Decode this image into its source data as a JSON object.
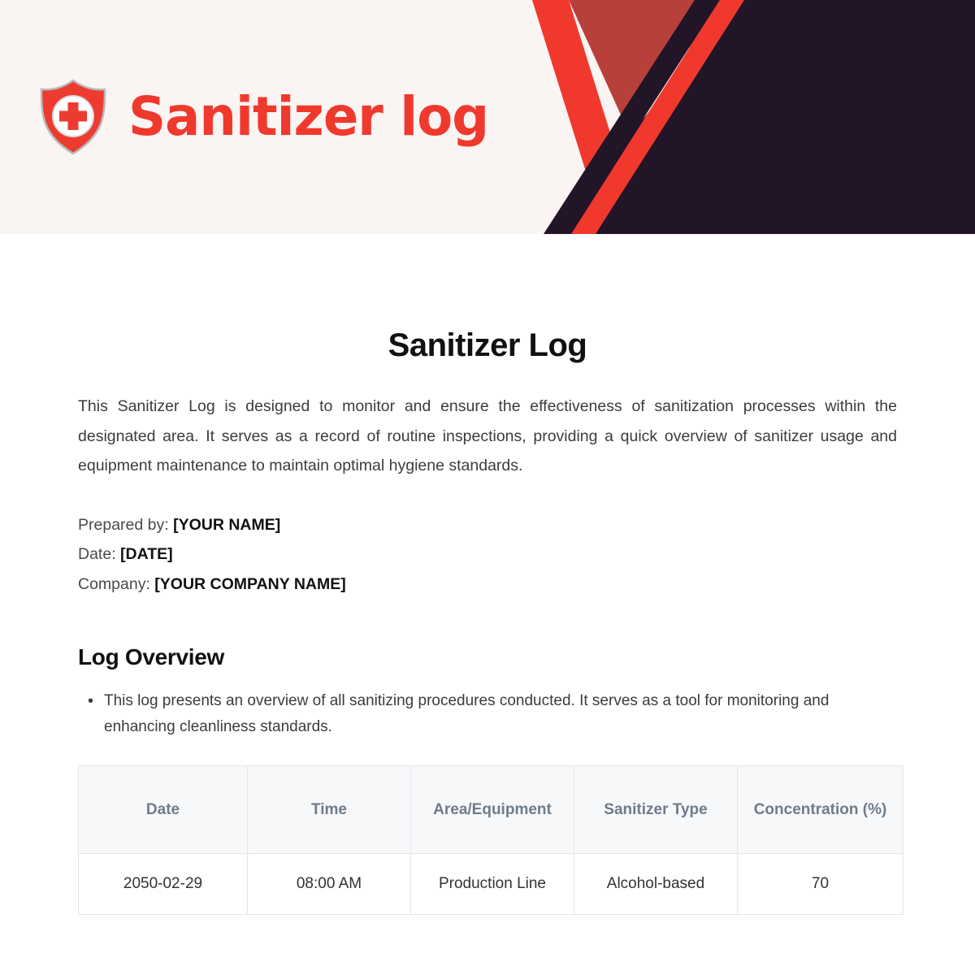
{
  "banner": {
    "title": "Sanitizer log",
    "logo_icon": "shield-medical-cross-icon",
    "colors": {
      "background": "#faf4f3",
      "title_red": "#f0392d",
      "bright_red": "#f1382c",
      "muted_red": "#b8403a",
      "dark": "#211527"
    }
  },
  "document": {
    "title": "Sanitizer Log",
    "intro": "This Sanitizer Log is designed to monitor and ensure the effectiveness of sanitization processes within the designated area. It serves as a record of routine inspections, providing a quick overview of sanitizer usage and equipment maintenance to maintain optimal hygiene standards.",
    "meta": [
      {
        "label": "Prepared by:",
        "value": "[YOUR NAME]"
      },
      {
        "label": "Date:",
        "value": "[DATE]"
      },
      {
        "label": "Company:",
        "value": "[YOUR COMPANY NAME]"
      }
    ],
    "overview": {
      "heading": "Log Overview",
      "bullets": [
        "This log presents an overview of all sanitizing procedures conducted. It serves as a tool for monitoring and enhancing cleanliness standards."
      ]
    },
    "table": {
      "headers": [
        "Date",
        "Time",
        "Area/Equipment",
        "Sanitizer Type",
        "Concentration (%)"
      ],
      "rows": [
        {
          "date": "2050-02-29",
          "time": "08:00 AM",
          "area": "Production Line",
          "type": "Alcohol-based",
          "concentration": "70"
        }
      ]
    }
  }
}
